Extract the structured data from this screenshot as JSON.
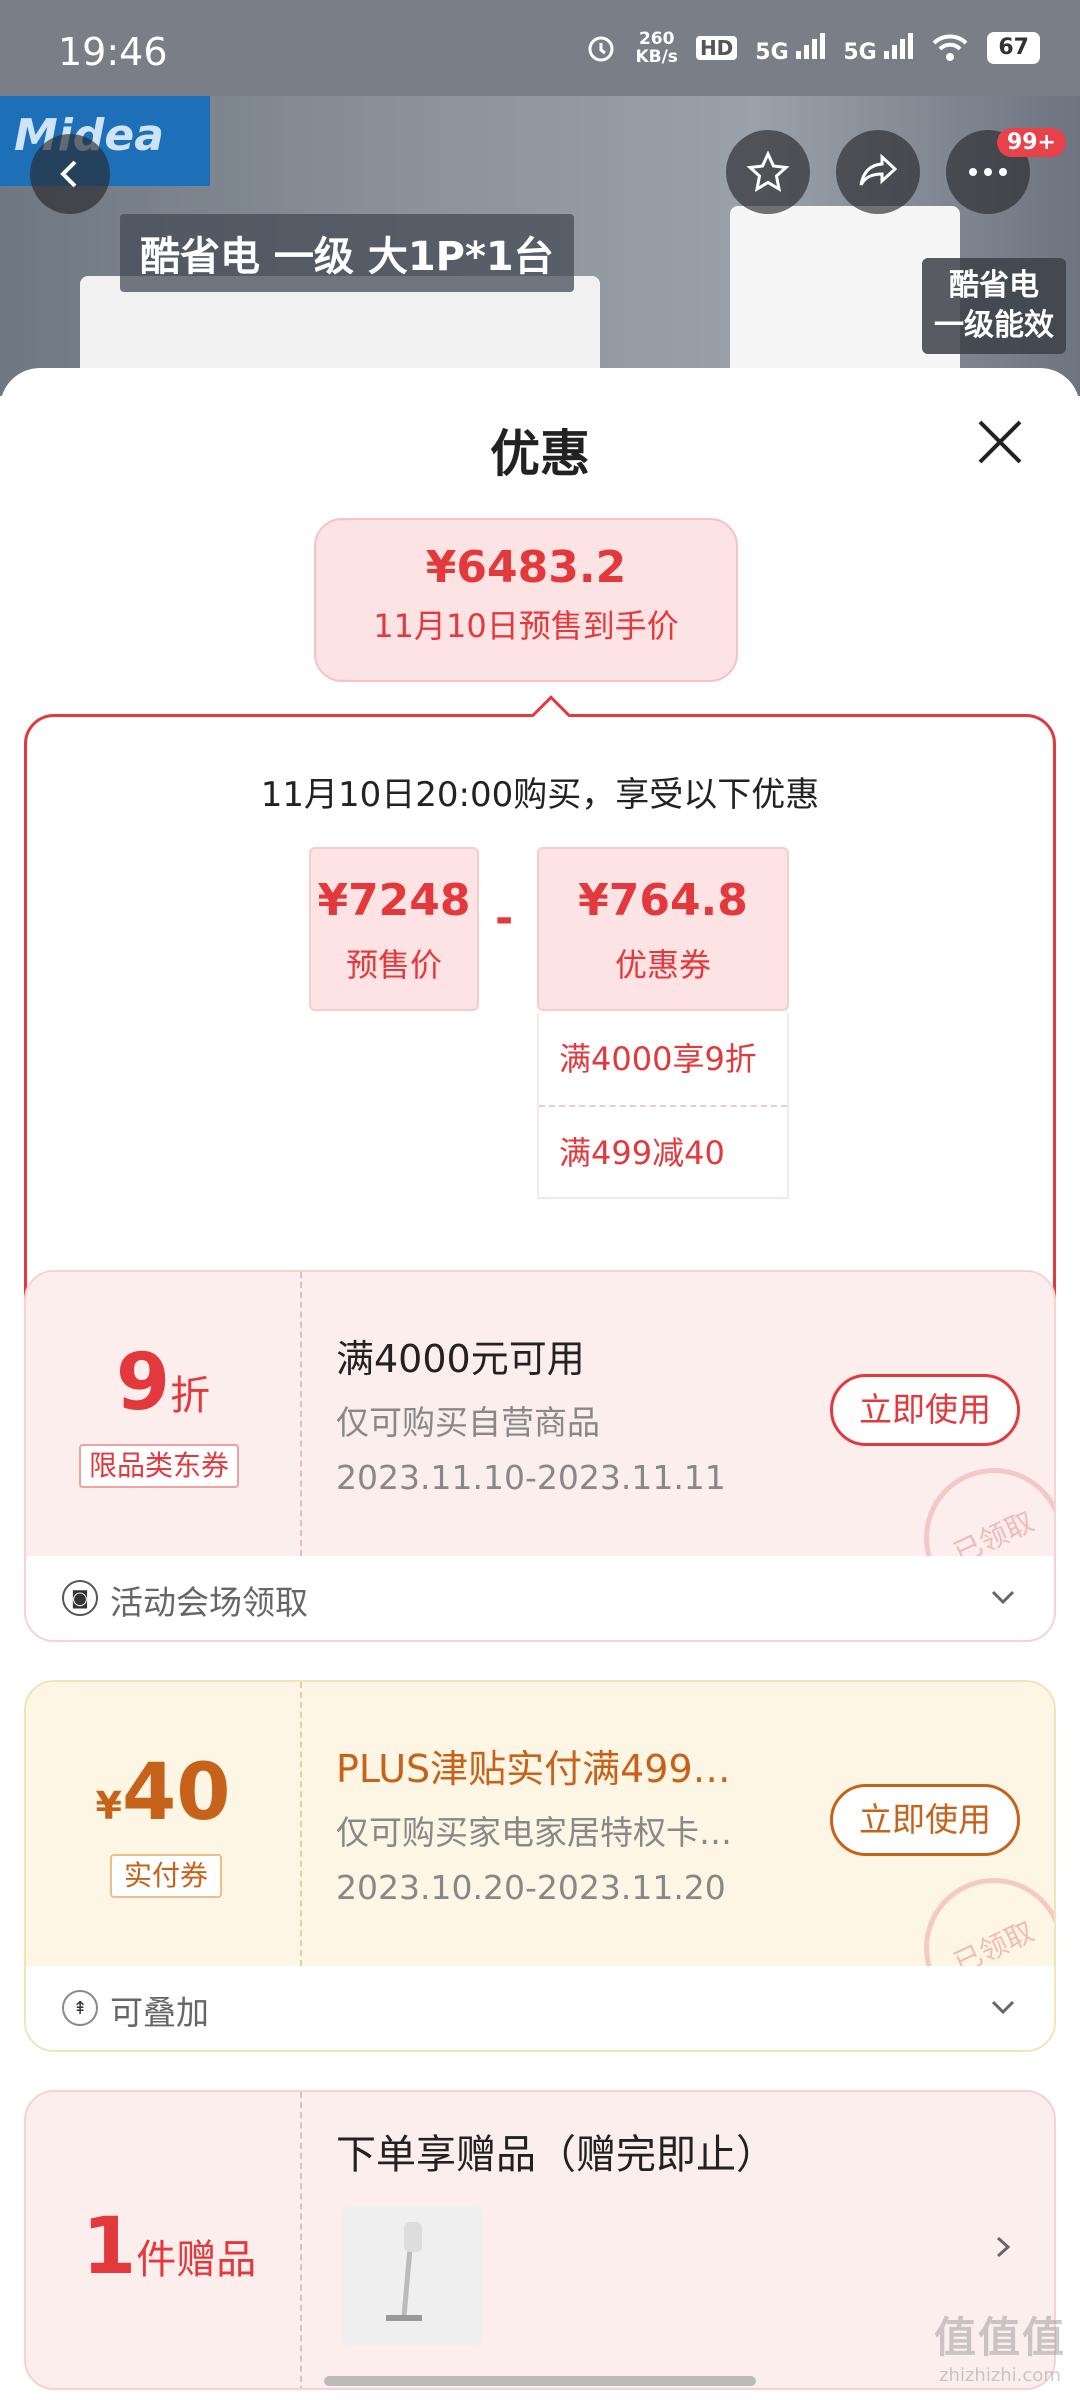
{
  "status_bar": {
    "time": "19:46",
    "net_speed_value": "260",
    "net_speed_unit": "KB/s",
    "hd_label": "HD",
    "signal_label_1": "5G",
    "signal_label_2": "5G",
    "battery": "67"
  },
  "banner": {
    "brand": "Midea",
    "headline": "酷省电 一级 大1P*1台",
    "side_tag_line1": "酷省电",
    "side_tag_line2": "一级能效",
    "more_badge": "99+"
  },
  "sheet": {
    "title": "优惠"
  },
  "final_price": {
    "amount": "¥6483.2",
    "label": "11月10日预售到手价"
  },
  "calc": {
    "headline": "11月10日20:00购买，享受以下优惠",
    "presale_price": "¥7248",
    "presale_label": "预售价",
    "minus": "-",
    "coupon_value": "¥764.8",
    "coupon_label": "优惠券",
    "rules": [
      "满4000享9折",
      "满499减40"
    ]
  },
  "coupon_discount": {
    "value": "9",
    "unit": "折",
    "tag": "限品类东券",
    "title": "满4000元可用",
    "subtitle": "仅可购买自营商品",
    "date": "2023.11.10-2023.11.11",
    "button": "立即使用",
    "stamp": "已领取",
    "footer": "活动会场领取"
  },
  "coupon_plus": {
    "symbol": "¥",
    "value": "40",
    "tag": "实付券",
    "title": "PLUS津贴实付满499…",
    "subtitle": "仅可购买家电家居特权卡…",
    "date": "2023.10.20-2023.11.20",
    "button": "立即使用",
    "stamp": "已领取",
    "footer": "可叠加"
  },
  "gift": {
    "count": "1",
    "unit": "件赠品",
    "title": "下单享赠品（赠完即止）"
  },
  "watermark": {
    "main": "值值值",
    "sub": "zhizhizhi.com"
  },
  "colors": {
    "accent_red": "#e4393c",
    "accent_gold": "#c7621a",
    "pink_bg": "#fde3e3",
    "gold_bg": "#fdf6e4"
  },
  "icons": [
    "back-icon",
    "star-icon",
    "share-icon",
    "more-icon",
    "close-icon",
    "chevron-down-icon",
    "chevron-right-icon",
    "venue-icon",
    "stack-icon"
  ]
}
